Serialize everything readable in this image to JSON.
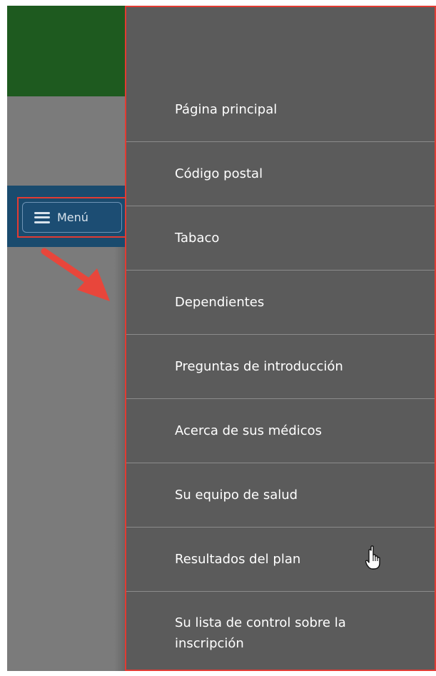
{
  "menu_button": {
    "label": "Menú",
    "icon": "hamburger-menu-icon"
  },
  "drawer": {
    "items": [
      {
        "label": "Página principal"
      },
      {
        "label": "Código postal"
      },
      {
        "label": "Tabaco"
      },
      {
        "label": "Dependientes"
      },
      {
        "label": "Preguntas de introducción"
      },
      {
        "label": "Acerca de sus médicos"
      },
      {
        "label": "Su equipo de salud"
      },
      {
        "label": "Resultados del plan"
      },
      {
        "label": "Su lista de control sobre la inscripción"
      }
    ]
  },
  "colors": {
    "header_green": "#1e5a1f",
    "menu_bar_blue": "#1a4b6e",
    "drawer_gray": "#5b5b5b",
    "highlight_red": "#e23b33",
    "arrow_red": "#e8463b"
  }
}
